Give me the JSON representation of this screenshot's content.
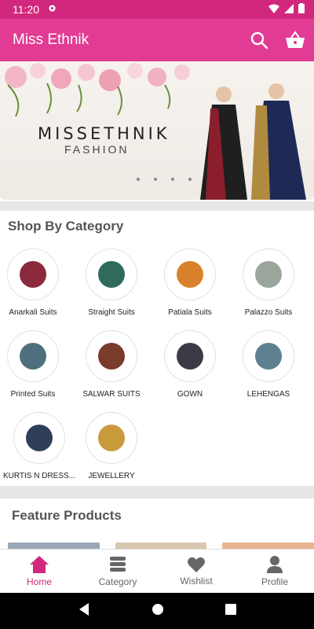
{
  "status_bar": {
    "time": "11:20"
  },
  "app_bar": {
    "title": "Miss Ethnik"
  },
  "banner": {
    "brand_title": "MISSETHNIK",
    "brand_subtitle": "FASHION"
  },
  "sections": {
    "categories_title": "Shop By Category",
    "featured_title": "Feature Products"
  },
  "categories": [
    {
      "label": "Anarkali Suits",
      "color": "#8a2a3c"
    },
    {
      "label": "Straight Suits",
      "color": "#2f6a5c"
    },
    {
      "label": "Patiala Suits",
      "color": "#d9822b"
    },
    {
      "label": "Palazzo Suits",
      "color": "#9aa59c"
    },
    {
      "label": "Printed Suits",
      "color": "#4f6f7c"
    },
    {
      "label": "SALWAR SUITS",
      "color": "#7a3b2a"
    },
    {
      "label": "GOWN",
      "color": "#3b3b46"
    },
    {
      "label": "LEHENGAS",
      "color": "#5d7f8e"
    },
    {
      "label": "KURTIS N DRESS...",
      "color": "#2f3f5a"
    },
    {
      "label": "JEWELLERY",
      "color": "#c79a3c"
    }
  ],
  "bottom_nav": {
    "home": "Home",
    "category": "Category",
    "wishlist": "Wishlist",
    "profile": "Profile"
  },
  "colors": {
    "primary": "#e23b93",
    "status": "#d1287d"
  }
}
